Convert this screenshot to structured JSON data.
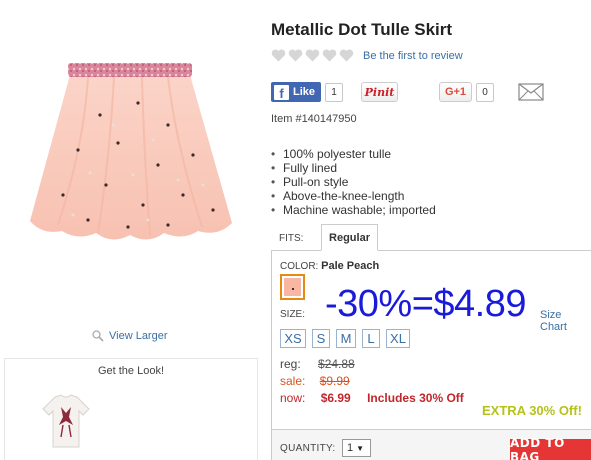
{
  "product": {
    "title": "Metallic Dot Tulle Skirt",
    "review_link": "Be the first to review",
    "item_number": "Item #140147950",
    "features": [
      "100% polyester tulle",
      "Fully lined",
      "Pull-on style",
      "Above-the-knee-length",
      "Machine washable; imported"
    ]
  },
  "social": {
    "like_label": "Like",
    "like_count": "1",
    "pinit_label": "Pinit",
    "gplus_label": "G+1",
    "gplus_count": "0"
  },
  "gallery": {
    "view_larger": "View Larger",
    "get_the_look": "Get the Look!"
  },
  "fits": {
    "label": "FITS:",
    "selected_tab": "Regular"
  },
  "color": {
    "label": "COLOR:",
    "value": "Pale Peach",
    "swatch_hex": "#f9b6a2"
  },
  "promo": "-30%=$4.89",
  "size": {
    "label": "SIZE:",
    "chart_link": "Size Chart",
    "options": [
      "XS",
      "S",
      "M",
      "L",
      "XL"
    ]
  },
  "price": {
    "reg_label": "reg:",
    "reg_value": "$24.88",
    "sale_label": "sale:",
    "sale_value": "$9.99",
    "now_label": "now:",
    "now_value": "$6.99",
    "includes": "Includes 30% Off",
    "extra_off": "EXTRA 30% Off!"
  },
  "quantity": {
    "label": "QUANTITY:",
    "value": "1"
  },
  "cart": {
    "add_label": "ADD TO BAG"
  },
  "colors": {
    "link": "#3a6ea5",
    "promo": "#1a1adb",
    "sale": "#d9531e",
    "now": "#c0272d",
    "extra": "#b5c21a",
    "add_to_bag": "#e63535",
    "facebook": "#4267b2"
  }
}
